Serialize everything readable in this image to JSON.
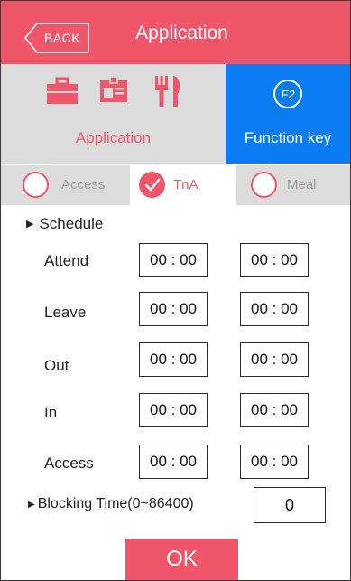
{
  "header": {
    "back_label": "BACK",
    "title": "Application",
    "color": "#f0566a"
  },
  "categories": {
    "application": {
      "label": "Application",
      "icons": [
        "briefcase-icon",
        "id-card-icon",
        "fork-knife-icon"
      ],
      "selected": false
    },
    "function_key": {
      "label": "Function key",
      "icon_text": "F2",
      "selected": true,
      "color": "#0a7bf0"
    }
  },
  "subtabs": [
    {
      "label": "Access",
      "selected": false
    },
    {
      "label": "TnA",
      "selected": true
    },
    {
      "label": "Meal",
      "selected": false
    }
  ],
  "schedule": {
    "title": "Schedule",
    "rows": [
      {
        "label": "Attend",
        "start": "00 : 00",
        "end": "00 : 00"
      },
      {
        "label": "Leave",
        "start": "00 : 00",
        "end": "00 : 00"
      },
      {
        "label": "Out",
        "start": "00 : 00",
        "end": "00 : 00"
      },
      {
        "label": "In",
        "start": "00 : 00",
        "end": "00 : 00"
      },
      {
        "label": "Access",
        "start": "00 : 00",
        "end": "00 : 00"
      }
    ]
  },
  "blocking": {
    "label": "Blocking Time(0~86400)",
    "value": "0"
  },
  "ok_label": "OK"
}
